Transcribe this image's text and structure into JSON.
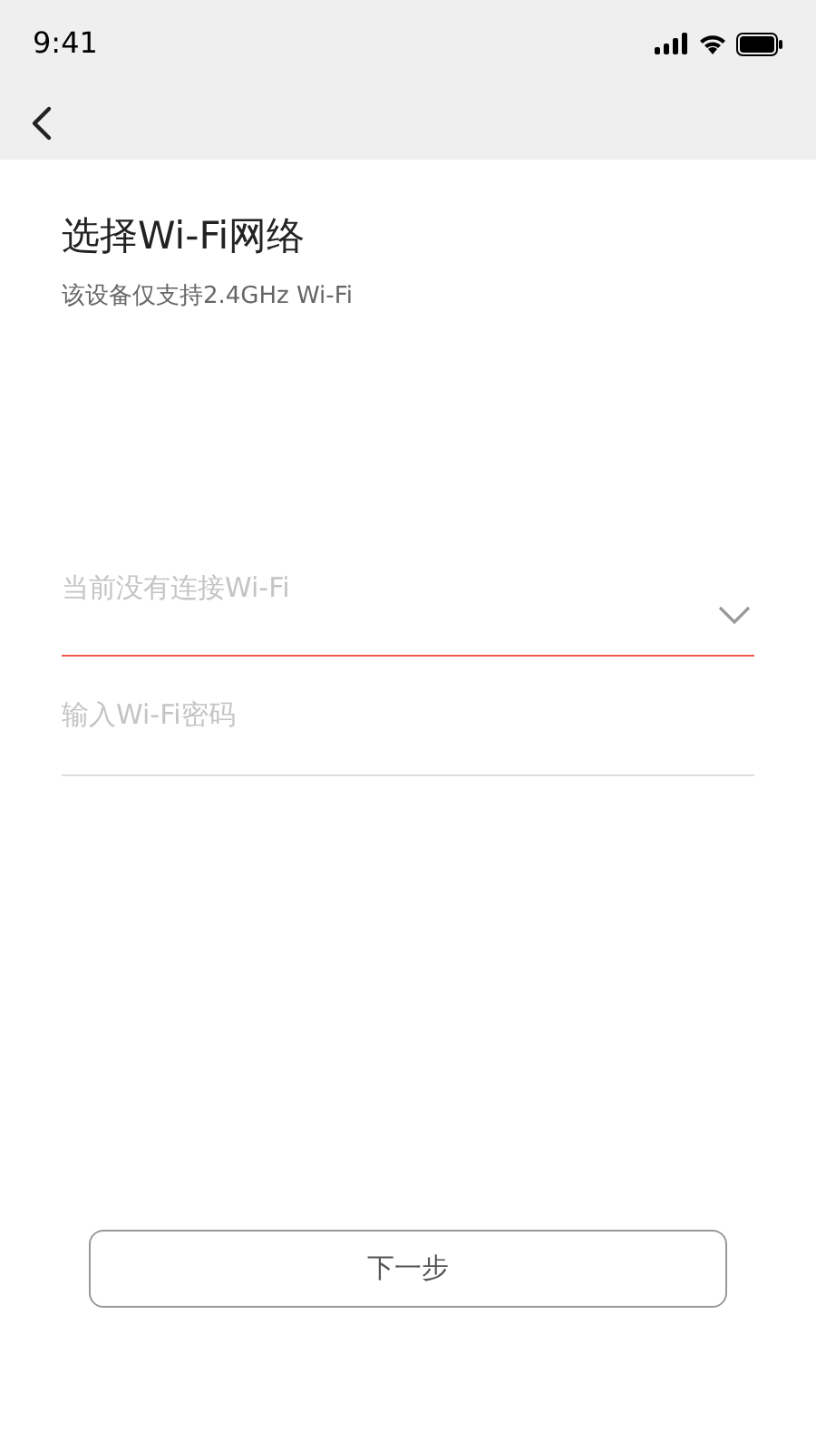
{
  "status_bar": {
    "time": "9:41"
  },
  "header": {
    "title": "选择Wi-Fi网络",
    "subtitle": "该设备仅支持2.4GHz Wi-Fi"
  },
  "fields": [
    {
      "kind": "select",
      "placeholder": "当前没有连接Wi-Fi",
      "focused": true
    },
    {
      "kind": "password",
      "placeholder": "输入Wi-Fi密码",
      "focused": false
    }
  ],
  "buttons": [
    {
      "label": "下一步"
    }
  ]
}
